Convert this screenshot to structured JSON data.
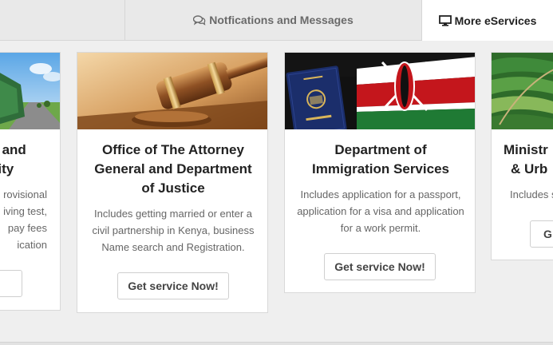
{
  "tabs": {
    "notifications_label": "Notfications and Messages",
    "more_label": "More eServices"
  },
  "cards": [
    {
      "title_lines": [
        "ort and",
        "rity"
      ],
      "desc_lines": [
        "rovisional",
        "iving test,",
        "pay fees",
        "ication"
      ],
      "button": "w!"
    },
    {
      "title_lines": [
        "Office of The Attorney",
        "General and Department",
        "of Justice"
      ],
      "desc_lines": [
        "Includes getting married or enter a",
        "civil partnership in Kenya, business",
        "Name search and Registration."
      ],
      "button": "Get service Now!"
    },
    {
      "title_lines": [
        "Department of",
        "Immigration Services"
      ],
      "desc_lines": [
        "Includes application for a passport,",
        "application for a visa and application",
        "for a work permit."
      ],
      "button": "Get service Now!"
    },
    {
      "title_lines": [
        "Ministr",
        "& Urb"
      ],
      "desc_lines": [
        "Includes s"
      ],
      "button": "G"
    }
  ],
  "colors": {
    "page_bg": "#efefef",
    "tab_bar_bg": "#e9e9e9",
    "active_tab_bg": "#ffffff",
    "card_bg": "#ffffff"
  },
  "icons": {
    "notifications": "comments-icon",
    "more_services": "monitor-icon"
  }
}
